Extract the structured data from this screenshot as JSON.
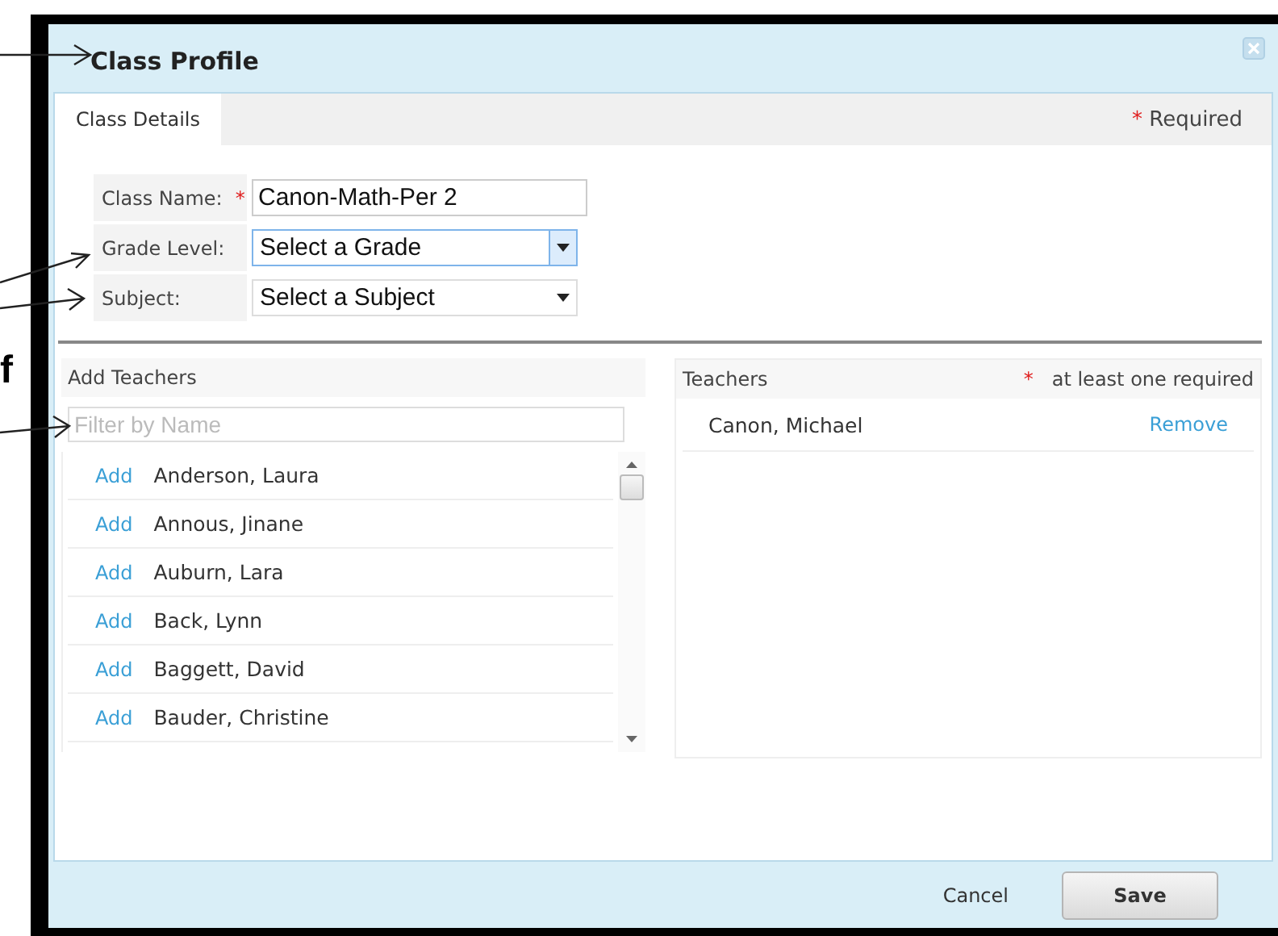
{
  "annotation": {
    "letter": "f"
  },
  "window": {
    "title": "Class Profile"
  },
  "tabs": [
    {
      "label": "Class Details",
      "selected": true
    }
  ],
  "required_note": {
    "mark": "*",
    "text": "Required"
  },
  "form": [
    {
      "kind": "text",
      "label": "Class Name:",
      "required_mark": "*",
      "value": "Canon-Math-Per 2",
      "focused": false
    },
    {
      "kind": "select",
      "label": "Grade Level:",
      "value": "Select a Grade",
      "focused": true
    },
    {
      "kind": "select",
      "label": "Subject:",
      "value": "Select a Subject",
      "focused": false
    }
  ],
  "add_teachers": {
    "title": "Add Teachers",
    "filter_placeholder": "Filter by Name",
    "items": [
      {
        "action": "Add",
        "name": "Anderson, Laura"
      },
      {
        "action": "Add",
        "name": "Annous, Jinane"
      },
      {
        "action": "Add",
        "name": "Auburn, Lara"
      },
      {
        "action": "Add",
        "name": "Back, Lynn"
      },
      {
        "action": "Add",
        "name": "Baggett, David"
      },
      {
        "action": "Add",
        "name": "Bauder, Christine"
      }
    ]
  },
  "teachers": {
    "title": "Teachers",
    "required_mark": "*",
    "required_note": "at least one required",
    "items": [
      {
        "name": "Canon, Michael",
        "action": "Remove"
      }
    ]
  },
  "buttons": {
    "cancel": "Cancel",
    "save": "Save"
  }
}
